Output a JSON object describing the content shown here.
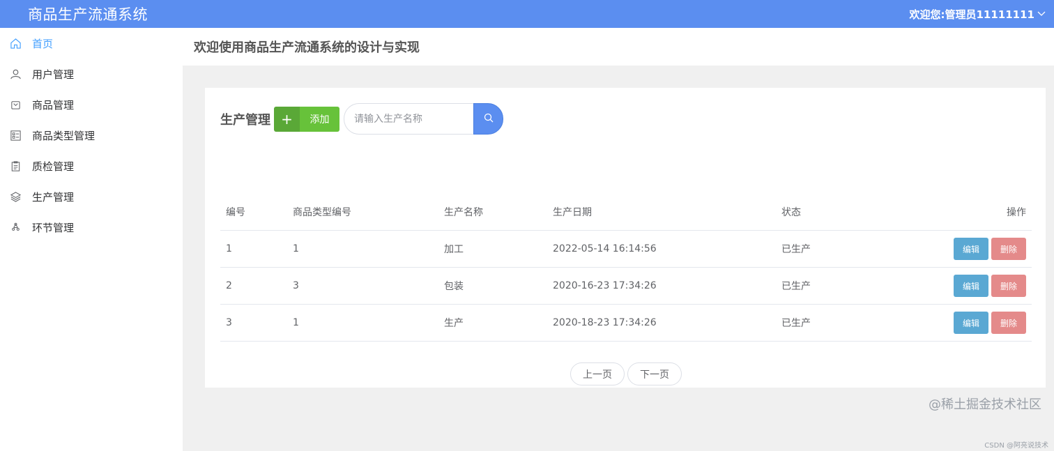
{
  "header": {
    "app_title": "商品生产流通系统",
    "user_greeting": "欢迎您:管理员11111111"
  },
  "sidebar": {
    "items": [
      {
        "label": "首页",
        "icon": "home-icon",
        "active": true
      },
      {
        "label": "用户管理",
        "icon": "user-icon"
      },
      {
        "label": "商品管理",
        "icon": "goods-icon"
      },
      {
        "label": "商品类型管理",
        "icon": "category-icon"
      },
      {
        "label": "质检管理",
        "icon": "clipboard-icon"
      },
      {
        "label": "生产管理",
        "icon": "layers-icon"
      },
      {
        "label": "环节管理",
        "icon": "recycle-icon"
      }
    ]
  },
  "page": {
    "welcome": "欢迎使用商品生产流通系统的设计与实现"
  },
  "toolbar": {
    "title": "生产管理",
    "add_plus": "+",
    "add_label": "添加",
    "search_placeholder": "请输入生产名称",
    "search_value": ""
  },
  "table": {
    "headers": {
      "id": "编号",
      "type_id": "商品类型编号",
      "name": "生产名称",
      "date": "生产日期",
      "status": "状态",
      "ops": "操作"
    },
    "rows": [
      {
        "id": "1",
        "type_id": "1",
        "name": "加工",
        "date": "2022-05-14 16:14:56",
        "status": "已生产"
      },
      {
        "id": "2",
        "type_id": "3",
        "name": "包装",
        "date": "2020-16-23 17:34:26",
        "status": "已生产"
      },
      {
        "id": "3",
        "type_id": "1",
        "name": "生产",
        "date": "2020-18-23 17:34:26",
        "status": "已生产"
      }
    ],
    "edit_label": "编辑",
    "delete_label": "删除"
  },
  "pager": {
    "prev": "上一页",
    "next": "下一页"
  },
  "watermark": {
    "main": "@稀土掘金技术社区",
    "sub": "CSDN @阿亮说技术"
  },
  "colors": {
    "header": "#5b8ef0",
    "accent": "#409eff",
    "add": "#67c23a",
    "edit": "#5aa8d3",
    "delete": "#e48a8a"
  }
}
